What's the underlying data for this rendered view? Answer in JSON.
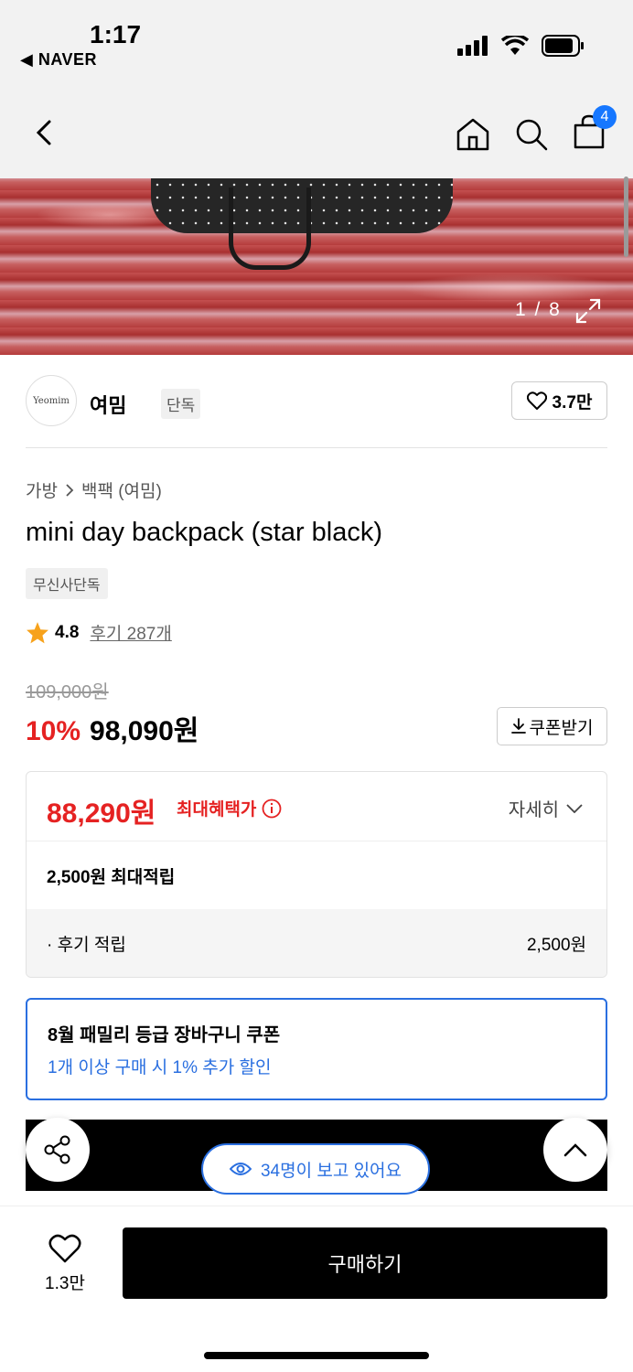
{
  "status_bar": {
    "time": "1:17",
    "back_app": "◀ NAVER"
  },
  "nav": {
    "cart_count": "4"
  },
  "gallery": {
    "counter": "1 / 8"
  },
  "brand": {
    "logo_text": "Yeomim",
    "name": "여밈",
    "tag": "단독",
    "likes": "3.7만"
  },
  "breadcrumb": {
    "category": "가방",
    "subcategory": "백팩 (여밈)"
  },
  "product": {
    "title": "mini day backpack (star black)",
    "badge": "무신사단독",
    "rating": "4.8",
    "reviews": "후기 287개",
    "original_price": "109,000원",
    "discount": "10%",
    "sale_price": "98,090원",
    "coupon_button": "쿠폰받기"
  },
  "benefit": {
    "max_price": "88,290원",
    "max_label": "최대혜택가",
    "detail_button": "자세히",
    "points": "2,500원 최대적립",
    "review_label": "· 후기 적립",
    "review_value": "2,500원"
  },
  "coupon_card": {
    "title": "8월 패밀리 등급 장바구니 쿠폰",
    "desc": "1개 이상 구매 시 1% 추가 할인"
  },
  "viewers": {
    "text": "34명이 보고 있어요"
  },
  "bottom": {
    "like_count": "1.3만",
    "buy_label": "구매하기"
  },
  "colors": {
    "accent_red": "#e52222",
    "accent_blue": "#2a6fe0",
    "badge_blue": "#1677ff"
  }
}
